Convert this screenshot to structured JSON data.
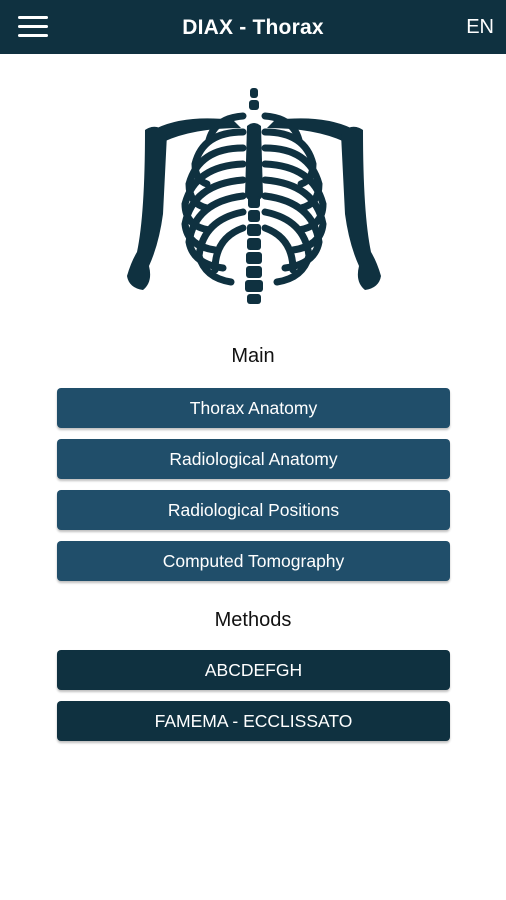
{
  "header": {
    "title": "DIAX - Thorax",
    "language": "EN",
    "menu_icon": "hamburger-menu-icon"
  },
  "hero": {
    "icon": "thorax-skeleton-icon"
  },
  "main": {
    "title": "Main",
    "items": [
      {
        "label": "Thorax Anatomy"
      },
      {
        "label": "Radiological Anatomy"
      },
      {
        "label": "Radiological Positions"
      },
      {
        "label": "Computed Tomography"
      }
    ]
  },
  "methods": {
    "title": "Methods",
    "items": [
      {
        "label": "ABCDEFGH"
      },
      {
        "label": "FAMEMA - ECCLISSATO"
      }
    ]
  },
  "colors": {
    "topbar": "#0f3140",
    "main_button": "#204e6a",
    "method_button": "#0f3140",
    "illustration": "#0f3140",
    "background": "#ffffff"
  }
}
